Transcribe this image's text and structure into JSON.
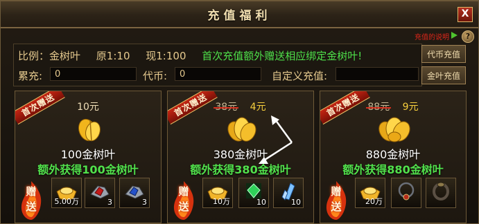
{
  "window": {
    "title": "充值福利",
    "close_label": "X",
    "top_link": "充值的说明",
    "help_label": "?"
  },
  "info": {
    "ratio_label": "比例：金树叶",
    "original_ratio": "原1:10",
    "current_ratio": "现1:100",
    "promo": "首次充值额外赠送相应绑定金树叶!",
    "total_label": "累充:",
    "total_value": "0",
    "coin_label": "代币:",
    "coin_value": "0",
    "custom_label": "自定义充值:",
    "custom_value": ""
  },
  "buttons": {
    "coin_recharge": "代币充值",
    "leaf_recharge": "金叶充值"
  },
  "cards": [
    {
      "ribbon": "首次赠送",
      "price_single": "10元",
      "amount": "100金树叶",
      "bonus": "额外获得100金树叶",
      "gift_label": "赠送",
      "items": [
        {
          "icon": "gold-ingot-icon",
          "count": "5.00万"
        },
        {
          "icon": "red-gem-icon",
          "count": "3"
        },
        {
          "icon": "blue-gem-icon",
          "count": "3"
        }
      ]
    },
    {
      "ribbon": "首次赠送",
      "price_old": "38元",
      "price_new": "4元",
      "amount": "380金树叶",
      "bonus": "额外获得380金树叶",
      "gift_label": "赠送",
      "items": [
        {
          "icon": "gold-ingot-icon",
          "count": "10万"
        },
        {
          "icon": "green-crystal-icon",
          "count": "10"
        },
        {
          "icon": "blue-crystal-icon",
          "count": "10"
        }
      ]
    },
    {
      "ribbon": "首次赠送",
      "price_old": "88元",
      "price_new": "9元",
      "amount": "880金树叶",
      "bonus": "额外获得880金树叶",
      "gift_label": "赠送",
      "items": [
        {
          "icon": "gold-ingot-icon",
          "count": "20万"
        },
        {
          "icon": "necklace-icon",
          "count": ""
        },
        {
          "icon": "ring-icon",
          "count": ""
        }
      ]
    }
  ]
}
